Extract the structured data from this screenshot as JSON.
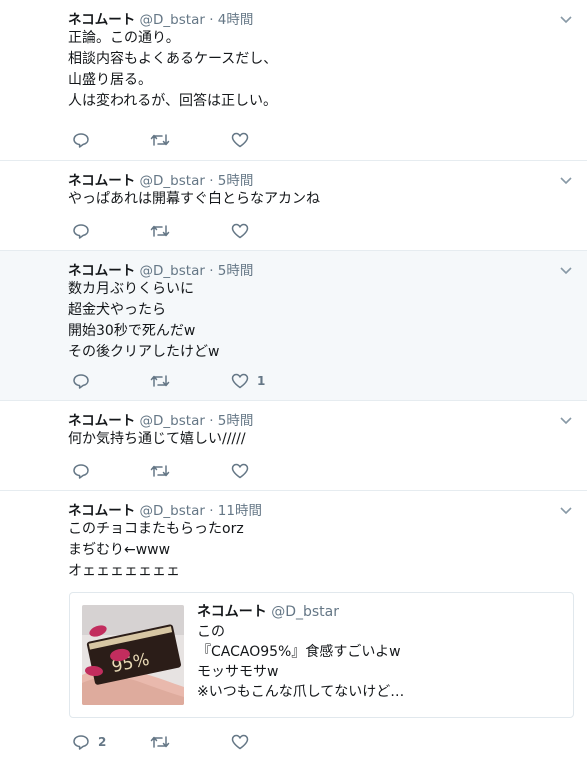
{
  "tweets": [
    {
      "name": "ネコムート",
      "handle": "@D_bstar",
      "time": "4時間",
      "lines": [
        "正論。この通り。",
        "相談内容もよくあるケースだし、",
        "山盛り居る。",
        "人は変われるが、回答は正しい。"
      ],
      "reply_count": "",
      "retweet_count": "",
      "like_count": ""
    },
    {
      "name": "ネコムート",
      "handle": "@D_bstar",
      "time": "5時間",
      "lines": [
        "やっぱあれは開幕すぐ白とらなアカンね"
      ],
      "reply_count": "",
      "retweet_count": "",
      "like_count": ""
    },
    {
      "name": "ネコムート",
      "handle": "@D_bstar",
      "time": "5時間",
      "lines": [
        "数カ月ぶりくらいに",
        "超金犬やったら",
        "開始30秒で死んだw",
        "その後クリアしたけどw"
      ],
      "reply_count": "",
      "retweet_count": "",
      "like_count": "1"
    },
    {
      "name": "ネコムート",
      "handle": "@D_bstar",
      "time": "5時間",
      "lines": [
        "何か気持ち通じて嬉しい/////"
      ],
      "reply_count": "",
      "retweet_count": "",
      "like_count": ""
    },
    {
      "name": "ネコムート",
      "handle": "@D_bstar",
      "time": "11時間",
      "lines": [
        "このチョコまたもらったorz",
        "まぢむり←www",
        "オェェェェェェェ"
      ],
      "reply_count": "2",
      "retweet_count": "",
      "like_count": "",
      "quote": {
        "name": "ネコムート",
        "handle": "@D_bstar",
        "lines": [
          "この",
          "『CACAO95%』食感すごいよw",
          "モッサモサw",
          "※いつもこんな爪してないけど…"
        ],
        "image_text": "95%"
      }
    }
  ],
  "colors": {
    "accent": "#1da1f2",
    "muted": "#657786",
    "icon": "#657786",
    "border": "#e6ecf0",
    "highlight_bg": "#f5f8fa"
  },
  "icons": {
    "reply": "reply-icon",
    "retweet": "retweet-icon",
    "like": "heart-icon",
    "caret": "chevron-down-icon"
  }
}
